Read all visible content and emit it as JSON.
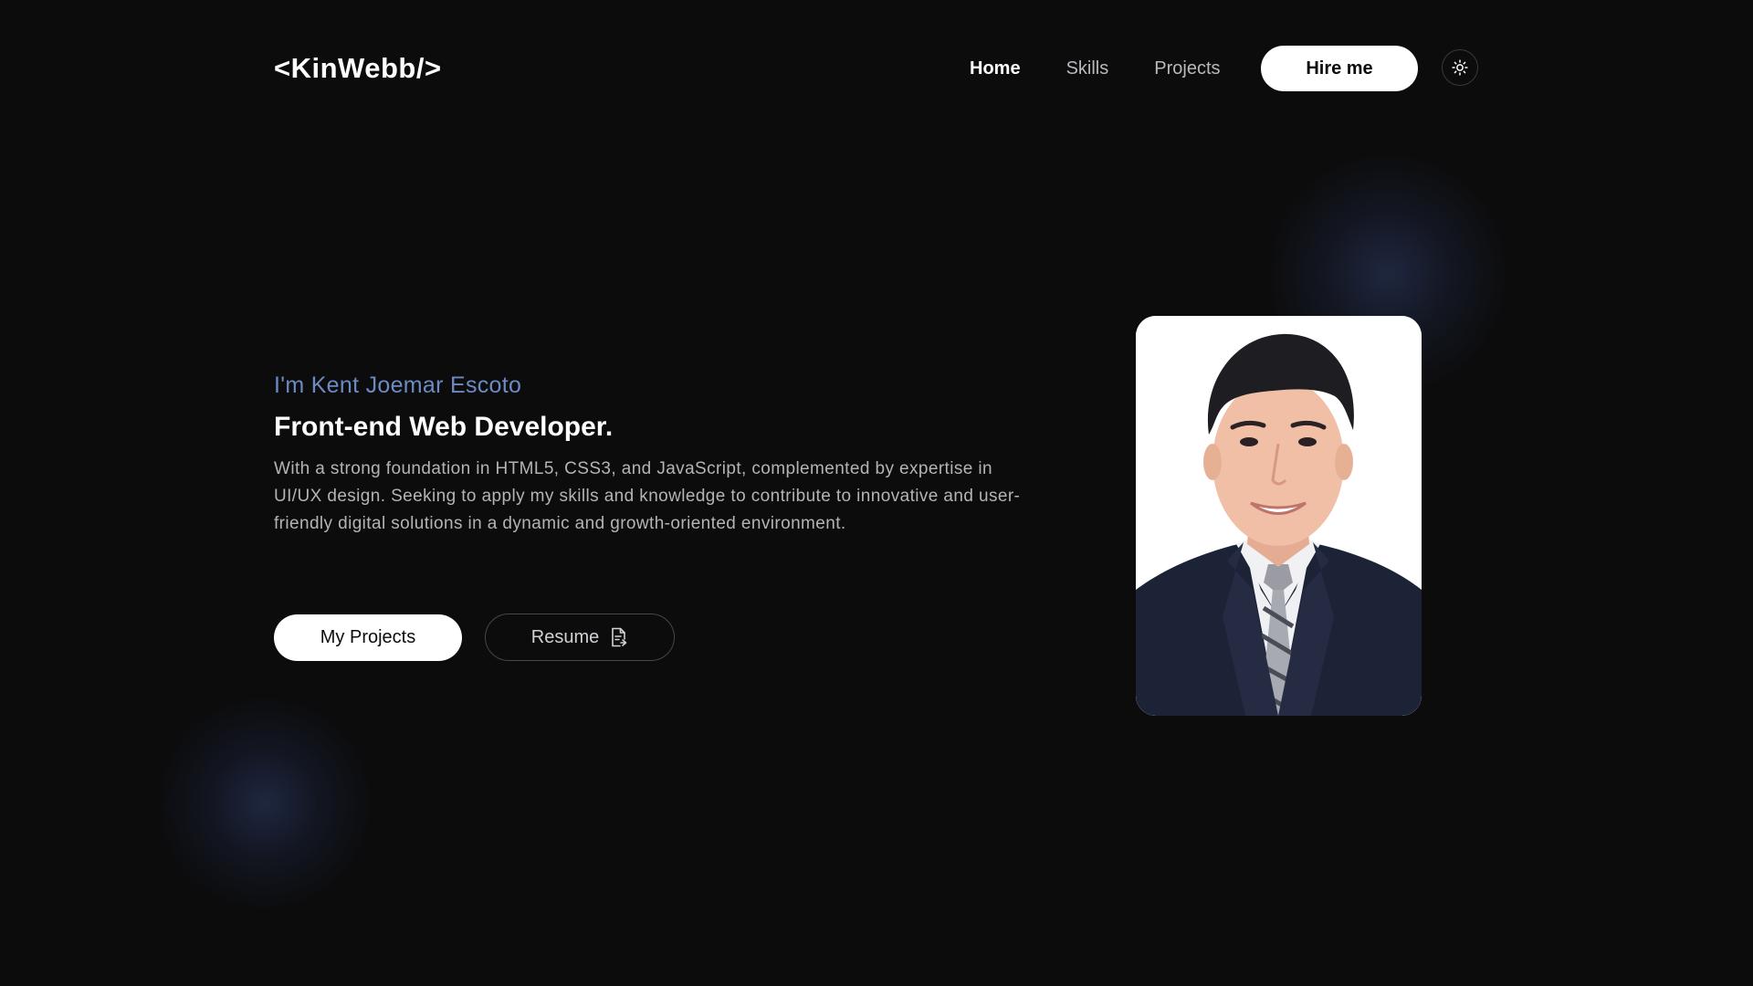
{
  "header": {
    "logo": "<KinWebb/>",
    "nav": [
      {
        "label": "Home",
        "active": true
      },
      {
        "label": "Skills",
        "active": false
      },
      {
        "label": "Projects",
        "active": false
      }
    ],
    "hire_label": "Hire me",
    "theme_icon": "sun-icon"
  },
  "hero": {
    "intro": "I'm Kent Joemar Escoto",
    "title": "Front-end Web Developer.",
    "description": "With a strong foundation in HTML5, CSS3, and JavaScript, complemented by expertise in UI/UX design. Seeking to apply my skills and knowledge to contribute to innovative and user-friendly digital solutions in a dynamic and growth-oriented environment.",
    "primary_button": "My Projects",
    "secondary_button": "Resume",
    "secondary_icon": "document-icon"
  },
  "portrait": {
    "alt": "profile-photo"
  },
  "colors": {
    "background": "#0c0c0d",
    "accent": "#6c8bc4",
    "text_primary": "#ffffff",
    "text_muted": "#b4b4b8"
  }
}
